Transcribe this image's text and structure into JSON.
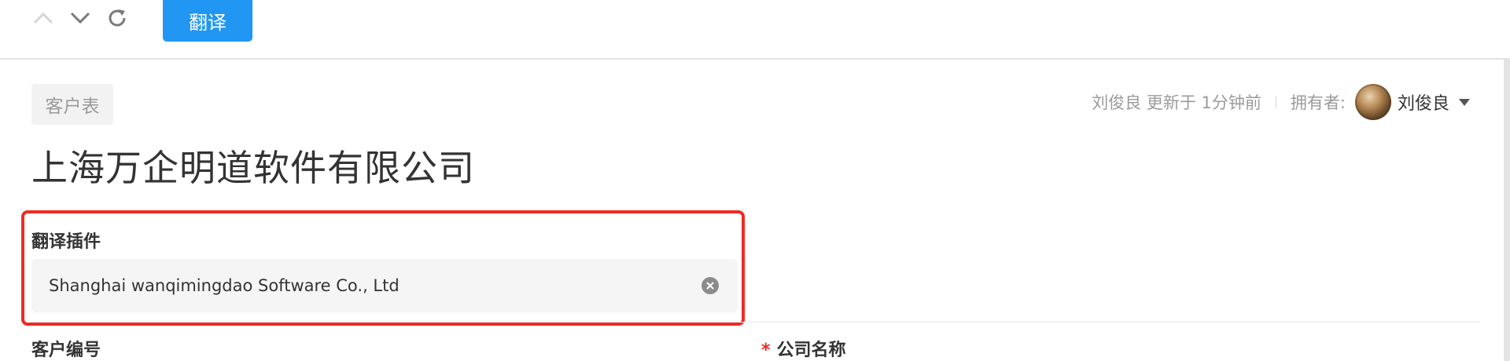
{
  "toolbar": {
    "nav_up_icon": "chevron-up-icon",
    "nav_down_icon": "chevron-down-icon",
    "refresh_icon": "refresh-icon",
    "translate_label": "翻译",
    "accent_color": "#2196f3"
  },
  "record": {
    "tag": "客户表",
    "title": "上海万企明道软件有限公司",
    "updated_text": "刘俊良 更新于 1分钟前",
    "owner_label": "拥有者:",
    "owner_name": "刘俊良"
  },
  "fields": {
    "translate_plugin": {
      "label": "翻译插件",
      "value": "Shanghai wanqimingdao Software Co., Ltd"
    },
    "customer_no": {
      "label": "客户编号"
    },
    "company_name": {
      "label": "公司名称",
      "required": "*"
    }
  },
  "highlight_color": "#f02a22"
}
